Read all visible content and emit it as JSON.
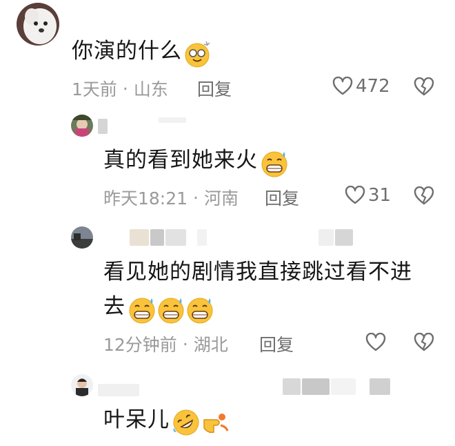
{
  "comments": [
    {
      "text": "你演的什么",
      "time": "1天前",
      "location": "山东",
      "reply": "回复",
      "likes": "472",
      "emoji": [
        "dizzy-face-emoji"
      ]
    },
    {
      "text": "真的看到她来火",
      "time": "昨天18:21",
      "location": "河南",
      "reply": "回复",
      "likes": "31",
      "emoji": [
        "grinning-sweat-emoji"
      ]
    },
    {
      "text_line1": "看见她的剧情我直接跳过看不进",
      "text_line2": "去",
      "time": "12分钟前",
      "location": "湖北",
      "reply": "回复",
      "likes": "",
      "emoji": [
        "grinning-sweat-emoji",
        "grinning-sweat-emoji",
        "grinning-sweat-emoji"
      ]
    },
    {
      "text": "叶呆儿",
      "emoji": [
        "rolling-laughing-emoji",
        "pointing-hand-emoji"
      ]
    }
  ],
  "separator": "·",
  "colors": {
    "meta": "#9a9a9a",
    "text": "#161616",
    "icon": "#6e6e6e",
    "emoji_yellow": "#f9c33b"
  }
}
